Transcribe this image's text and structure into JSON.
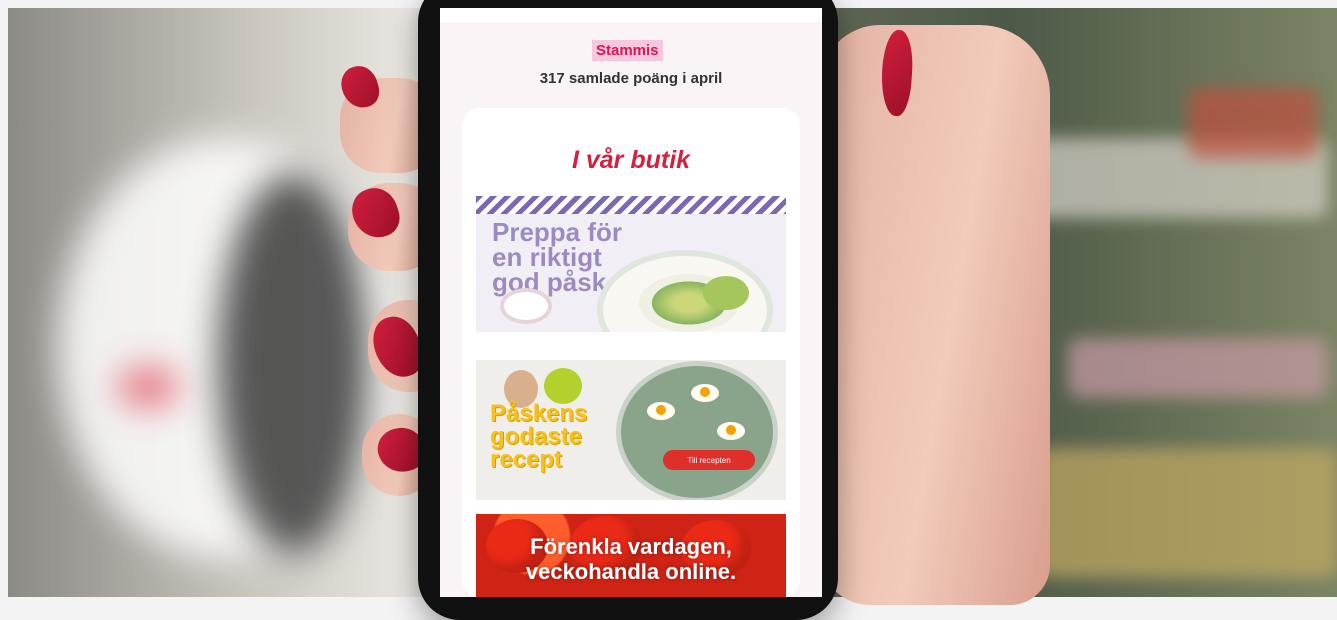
{
  "screen": {
    "brand_badge": "Stammis",
    "points_text": "317 samlade poäng i april",
    "section_title": "I vår butik",
    "banners": [
      {
        "headline": "Preppa för en riktigt god påsk"
      },
      {
        "headline": "Påskens godaste recept",
        "button_label": "Till recepten"
      },
      {
        "headline": "Förenkla vardagen, veckohandla online."
      }
    ]
  },
  "colors": {
    "brand_red": "#d51f3d",
    "lavender": "#9d8bbf",
    "easter_yellow": "#f7c11d",
    "nail_red": "#c71c36"
  },
  "icons": [
    "easter-eggs",
    "salad-plate",
    "egg-salad-plate",
    "tomatoes"
  ]
}
